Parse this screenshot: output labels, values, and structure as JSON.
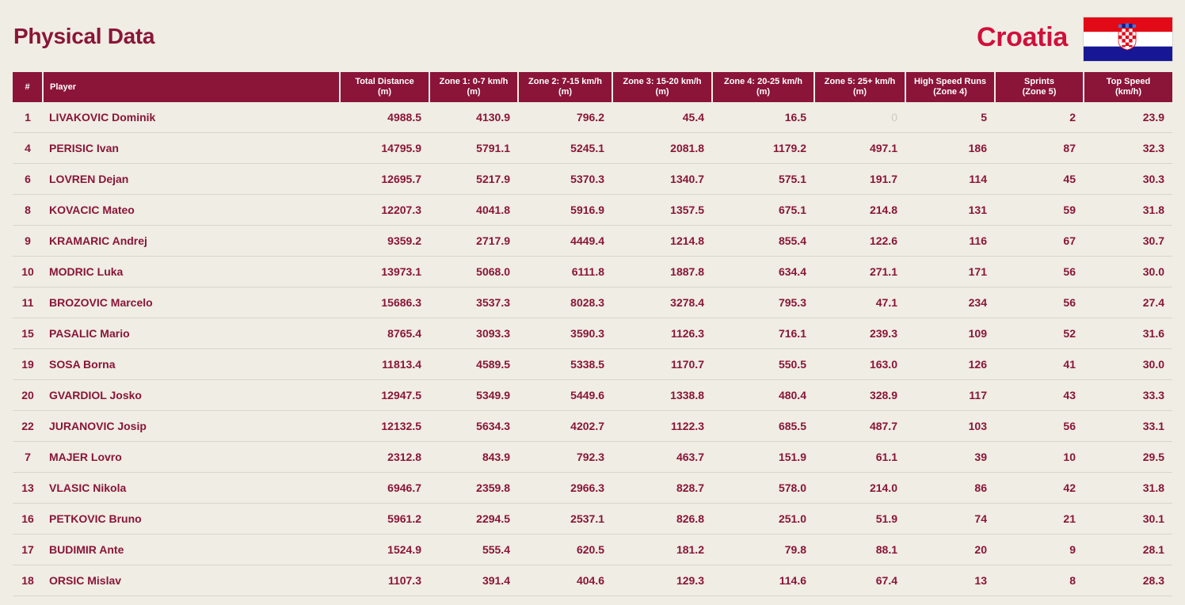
{
  "header": {
    "title": "Physical Data",
    "team": "Croatia"
  },
  "flag": {
    "icon": "croatia-flag-icon",
    "colors": {
      "red": "#e30a17",
      "white": "#ffffff",
      "blue": "#171796"
    }
  },
  "colors": {
    "primary": "#8a1538",
    "accent": "#d0103a",
    "background": "#efede4"
  },
  "table": {
    "columns": [
      {
        "line1": "#",
        "line2": ""
      },
      {
        "line1": "Player",
        "line2": ""
      },
      {
        "line1": "Total Distance",
        "line2": "(m)"
      },
      {
        "line1": "Zone 1: 0-7 km/h",
        "line2": "(m)"
      },
      {
        "line1": "Zone 2: 7-15 km/h",
        "line2": "(m)"
      },
      {
        "line1": "Zone 3: 15-20 km/h",
        "line2": "(m)"
      },
      {
        "line1": "Zone 4: 20-25 km/h",
        "line2": "(m)"
      },
      {
        "line1": "Zone 5: 25+ km/h",
        "line2": "(m)"
      },
      {
        "line1": "High Speed Runs",
        "line2": "(Zone 4)"
      },
      {
        "line1": "Sprints",
        "line2": "(Zone 5)"
      },
      {
        "line1": "Top Speed",
        "line2": "(km/h)"
      }
    ],
    "rows": [
      [
        "1",
        "LIVAKOVIC Dominik",
        "4988.5",
        "4130.9",
        "796.2",
        "45.4",
        "16.5",
        "0",
        "5",
        "2",
        "23.9"
      ],
      [
        "4",
        "PERISIC Ivan",
        "14795.9",
        "5791.1",
        "5245.1",
        "2081.8",
        "1179.2",
        "497.1",
        "186",
        "87",
        "32.3"
      ],
      [
        "6",
        "LOVREN Dejan",
        "12695.7",
        "5217.9",
        "5370.3",
        "1340.7",
        "575.1",
        "191.7",
        "114",
        "45",
        "30.3"
      ],
      [
        "8",
        "KOVACIC Mateo",
        "12207.3",
        "4041.8",
        "5916.9",
        "1357.5",
        "675.1",
        "214.8",
        "131",
        "59",
        "31.8"
      ],
      [
        "9",
        "KRAMARIC Andrej",
        "9359.2",
        "2717.9",
        "4449.4",
        "1214.8",
        "855.4",
        "122.6",
        "116",
        "67",
        "30.7"
      ],
      [
        "10",
        "MODRIC Luka",
        "13973.1",
        "5068.0",
        "6111.8",
        "1887.8",
        "634.4",
        "271.1",
        "171",
        "56",
        "30.0"
      ],
      [
        "11",
        "BROZOVIC Marcelo",
        "15686.3",
        "3537.3",
        "8028.3",
        "3278.4",
        "795.3",
        "47.1",
        "234",
        "56",
        "27.4"
      ],
      [
        "15",
        "PASALIC Mario",
        "8765.4",
        "3093.3",
        "3590.3",
        "1126.3",
        "716.1",
        "239.3",
        "109",
        "52",
        "31.6"
      ],
      [
        "19",
        "SOSA Borna",
        "11813.4",
        "4589.5",
        "5338.5",
        "1170.7",
        "550.5",
        "163.0",
        "126",
        "41",
        "30.0"
      ],
      [
        "20",
        "GVARDIOL Josko",
        "12947.5",
        "5349.9",
        "5449.6",
        "1338.8",
        "480.4",
        "328.9",
        "117",
        "43",
        "33.3"
      ],
      [
        "22",
        "JURANOVIC Josip",
        "12132.5",
        "5634.3",
        "4202.7",
        "1122.3",
        "685.5",
        "487.7",
        "103",
        "56",
        "33.1"
      ],
      [
        "7",
        "MAJER Lovro",
        "2312.8",
        "843.9",
        "792.3",
        "463.7",
        "151.9",
        "61.1",
        "39",
        "10",
        "29.5"
      ],
      [
        "13",
        "VLASIC Nikola",
        "6946.7",
        "2359.8",
        "2966.3",
        "828.7",
        "578.0",
        "214.0",
        "86",
        "42",
        "31.8"
      ],
      [
        "16",
        "PETKOVIC Bruno",
        "5961.2",
        "2294.5",
        "2537.1",
        "826.8",
        "251.0",
        "51.9",
        "74",
        "21",
        "30.1"
      ],
      [
        "17",
        "BUDIMIR Ante",
        "1524.9",
        "555.4",
        "620.5",
        "181.2",
        "79.8",
        "88.1",
        "20",
        "9",
        "28.1"
      ],
      [
        "18",
        "ORSIC Mislav",
        "1107.3",
        "391.4",
        "404.6",
        "129.3",
        "114.6",
        "67.4",
        "13",
        "8",
        "28.3"
      ]
    ]
  }
}
